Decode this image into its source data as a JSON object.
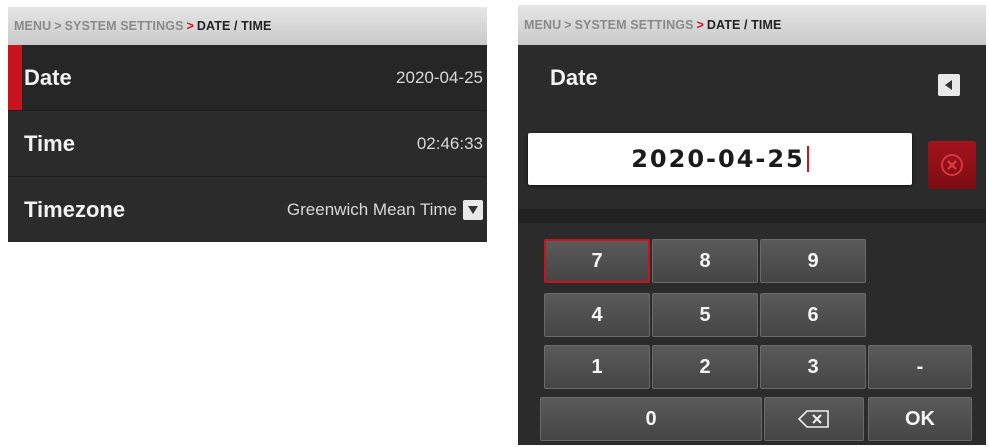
{
  "breadcrumb": {
    "menu": "MENU",
    "separator1": ">",
    "system_settings": "SYSTEM SETTINGS",
    "separator2": ">",
    "current": "DATE / TIME"
  },
  "settings_list": {
    "rows": [
      {
        "label": "Date",
        "value": "2020-04-25"
      },
      {
        "label": "Time",
        "value": "02:46:33"
      },
      {
        "label": "Timezone",
        "value": "Greenwich Mean Time"
      }
    ]
  },
  "editor": {
    "title": "Date",
    "input_value": "2020-04-25",
    "keypad": {
      "k7": "7",
      "k8": "8",
      "k9": "9",
      "k4": "4",
      "k5": "5",
      "k6": "6",
      "k1": "1",
      "k2": "2",
      "k3": "3",
      "dash": "-",
      "k0": "0",
      "ok": "OK"
    }
  },
  "icons": {
    "dropdown": "chevron-down-icon",
    "back": "back-arrow-icon",
    "clear": "clear-x-icon",
    "backspace": "backspace-icon"
  },
  "colors": {
    "accent": "#c8141e",
    "panel_bg": "#2b2b2b",
    "breadcrumb_bg": "#d8d8d8",
    "key_bg": "#505050"
  }
}
